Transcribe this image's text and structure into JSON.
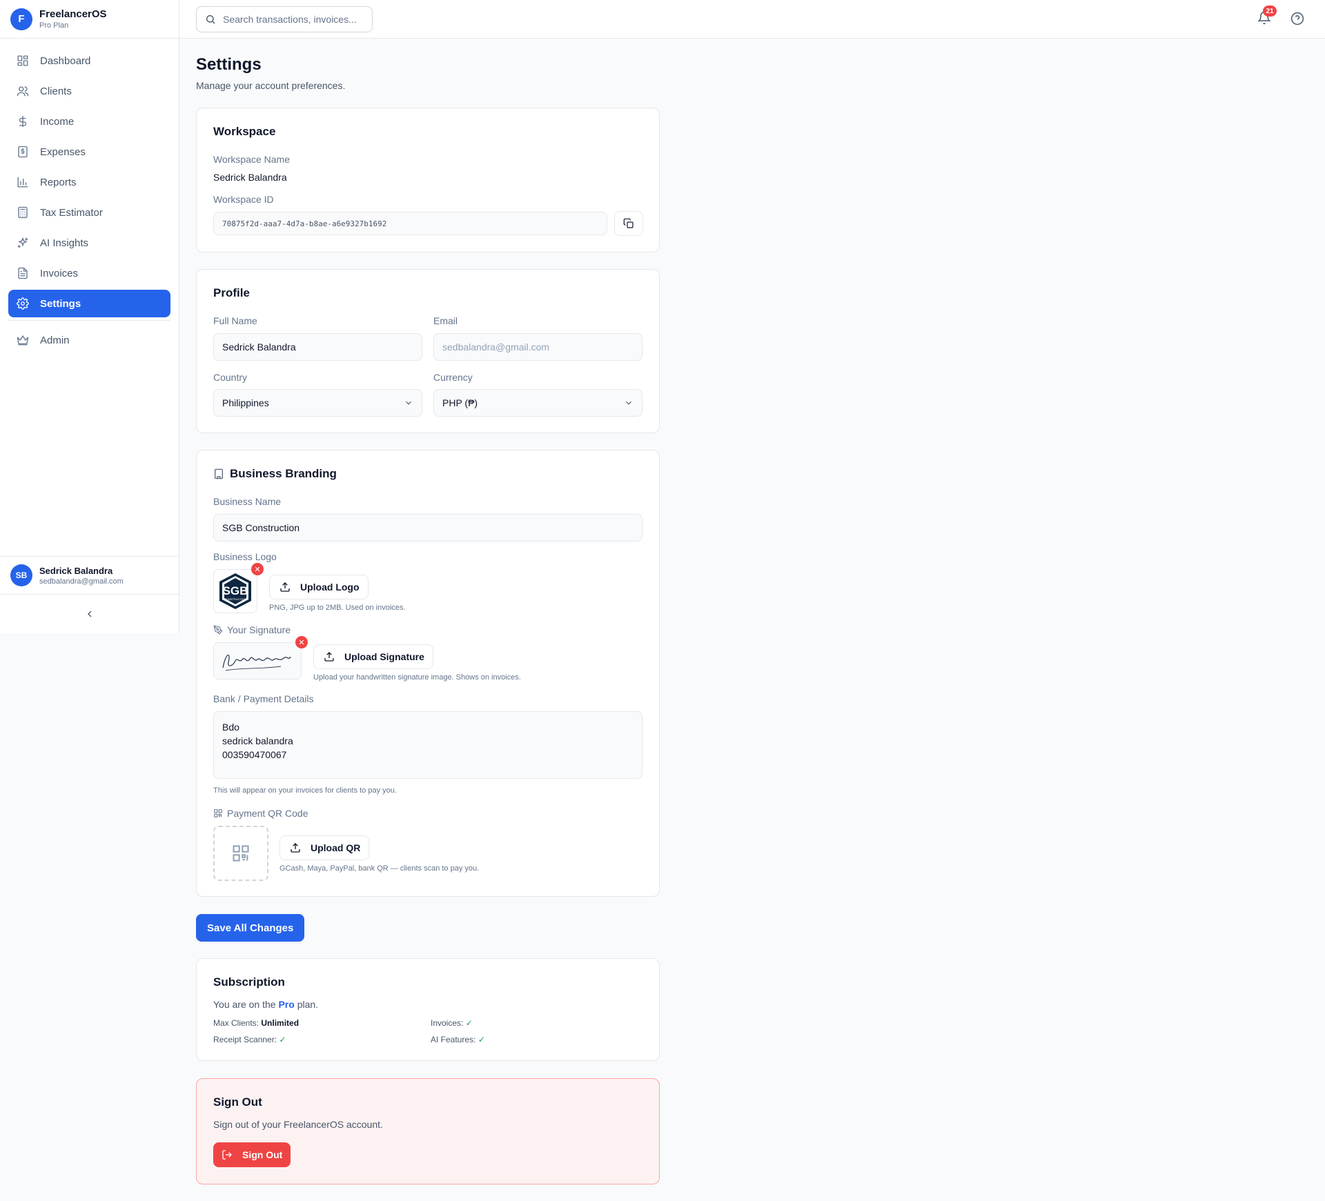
{
  "brand": {
    "logo_letter": "F",
    "name": "FreelancerOS",
    "plan": "Pro Plan"
  },
  "nav": [
    {
      "label": "Dashboard",
      "icon": "dashboard-icon"
    },
    {
      "label": "Clients",
      "icon": "users-icon"
    },
    {
      "label": "Income",
      "icon": "dollar-icon"
    },
    {
      "label": "Expenses",
      "icon": "receipt-icon"
    },
    {
      "label": "Reports",
      "icon": "bar-chart-icon"
    },
    {
      "label": "Tax Estimator",
      "icon": "calculator-icon"
    },
    {
      "label": "AI Insights",
      "icon": "sparkles-icon"
    },
    {
      "label": "Invoices",
      "icon": "file-icon"
    },
    {
      "label": "Settings",
      "icon": "gear-icon",
      "active": true
    },
    {
      "label": "Admin",
      "icon": "crown-icon"
    }
  ],
  "user": {
    "initials": "SB",
    "name": "Sedrick Balandra",
    "email": "sedbalandra@gmail.com"
  },
  "topbar": {
    "search_placeholder": "Search transactions, invoices...",
    "notification_count": "21"
  },
  "page": {
    "title": "Settings",
    "subtitle": "Manage your account preferences."
  },
  "workspace": {
    "title": "Workspace",
    "name_label": "Workspace Name",
    "name_value": "Sedrick Balandra",
    "id_label": "Workspace ID",
    "id_value": "70875f2d-aaa7-4d7a-b8ae-a6e9327b1692"
  },
  "profile": {
    "title": "Profile",
    "full_name_label": "Full Name",
    "full_name_value": "Sedrick Balandra",
    "email_label": "Email",
    "email_value": "sedbalandra@gmail.com",
    "country_label": "Country",
    "country_value": "Philippines",
    "currency_label": "Currency",
    "currency_value": "PHP (₱)"
  },
  "branding": {
    "title": "Business Branding",
    "business_name_label": "Business Name",
    "business_name_value": "SGB Construction",
    "logo_label": "Business Logo",
    "logo_text": "SGB",
    "logo_subtext": "CONSTRUCTION",
    "upload_logo": "Upload Logo",
    "logo_hint": "PNG, JPG up to 2MB. Used on invoices.",
    "signature_label": "Your Signature",
    "upload_signature": "Upload Signature",
    "signature_hint": "Upload your handwritten signature image. Shows on invoices.",
    "bank_label": "Bank / Payment Details",
    "bank_lines": [
      "Bdo",
      "sedrick balandra",
      "003590470067"
    ],
    "bank_hint": "This will appear on your invoices for clients to pay you.",
    "qr_label": "Payment QR Code",
    "upload_qr": "Upload QR",
    "qr_hint": "GCash, Maya, PayPal, bank QR — clients scan to pay you."
  },
  "save_button": "Save All Changes",
  "subscription": {
    "title": "Subscription",
    "text_before": "You are on the",
    "plan": "Pro",
    "text_after": "plan.",
    "features": [
      {
        "label": "Max Clients:",
        "value": "Unlimited"
      },
      {
        "label": "Invoices:",
        "value": "✓"
      },
      {
        "label": "Receipt Scanner:",
        "value": "✓"
      },
      {
        "label": "AI Features:",
        "value": "✓"
      }
    ]
  },
  "signout": {
    "title": "Sign Out",
    "description": "Sign out of your FreelancerOS account.",
    "button": "Sign Out"
  }
}
